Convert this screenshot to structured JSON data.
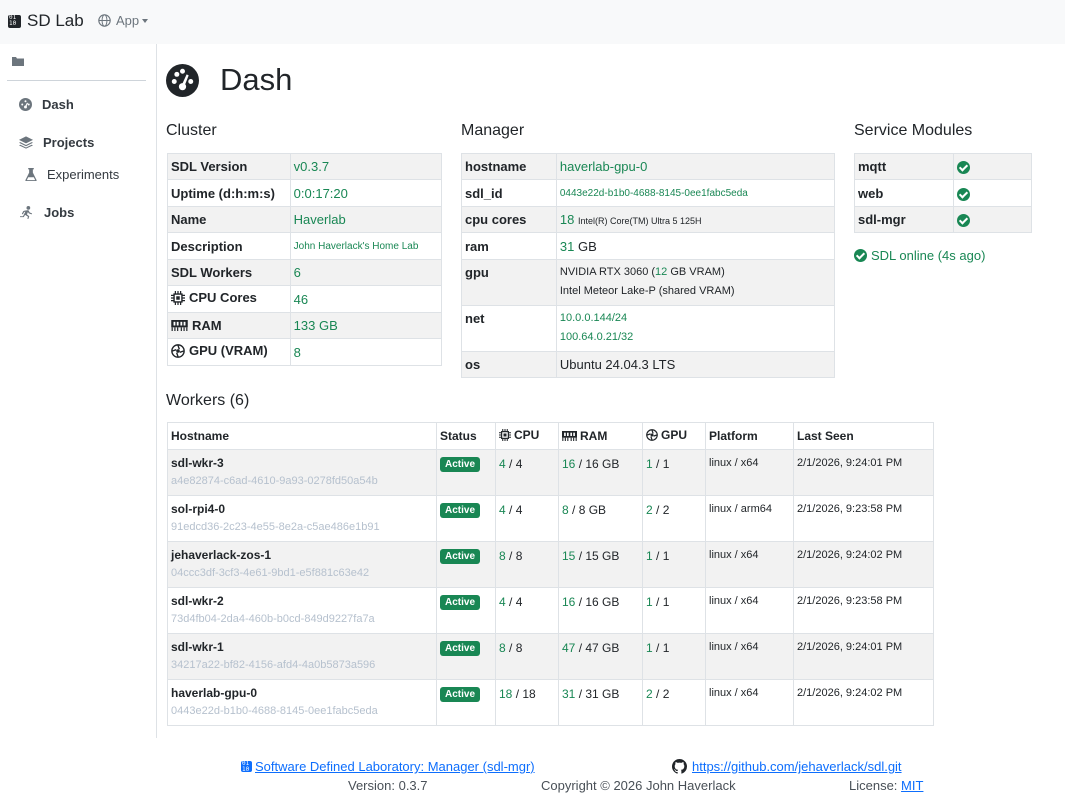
{
  "navbar": {
    "brand": "SD Lab",
    "app_menu": "App"
  },
  "sidebar": {
    "items": [
      {
        "label": "Dash",
        "icon": "gauge-icon"
      },
      {
        "label": "Projects",
        "icon": "layers-icon"
      },
      {
        "label": "Experiments",
        "icon": "flask-icon"
      },
      {
        "label": "Jobs",
        "icon": "person-running-icon"
      }
    ]
  },
  "page": {
    "title": "Dash"
  },
  "cluster": {
    "heading": "Cluster",
    "sdl_version_label": "SDL Version",
    "sdl_version": "v0.3.7",
    "uptime_label": "Uptime (d:h:m:s)",
    "uptime": "0:0:17:20",
    "name_label": "Name",
    "name": "Haverlab",
    "description_label": "Description",
    "description": "John Haverlack's Home Lab",
    "workers_label": "SDL Workers",
    "workers": "6",
    "cpu_label": "CPU Cores",
    "cpu": "46",
    "ram_label": "RAM",
    "ram": "133 GB",
    "gpu_label": "GPU (VRAM)",
    "gpu": "8"
  },
  "manager": {
    "heading": "Manager",
    "hostname_label": "hostname",
    "hostname": "haverlab-gpu-0",
    "sdl_id_label": "sdl_id",
    "sdl_id": "0443e22d-b1b0-4688-8145-0ee1fabc5eda",
    "cpu_label": "cpu cores",
    "cpu_count": "18",
    "cpu_model": "Intel(R) Core(TM) Ultra 5 125H",
    "ram_label": "ram",
    "ram_value": "31",
    "ram_unit": "GB",
    "gpu_label": "gpu",
    "gpu1_pre": "NVIDIA RTX 3060 (",
    "gpu1_vram": "12",
    "gpu1_post": " GB VRAM)",
    "gpu2": "Intel Meteor Lake-P (shared VRAM)",
    "net_label": "net",
    "net1": "10.0.0.144/24",
    "net2": "100.64.0.21/32",
    "os_label": "os",
    "os": "Ubuntu 24.04.3 LTS"
  },
  "services": {
    "heading": "Service Modules",
    "modules": [
      "mqtt",
      "web",
      "sdl-mgr"
    ],
    "status": "SDL online (4s ago)"
  },
  "workers": {
    "heading": "Workers (6)",
    "columns": {
      "hostname": "Hostname",
      "status": "Status",
      "cpu": "CPU",
      "ram": "RAM",
      "gpu": "GPU",
      "platform": "Platform",
      "last_seen": "Last Seen"
    },
    "rows": [
      {
        "host": "sdl-wkr-3",
        "id": "a4e82874-c6ad-4610-9a93-0278fd50a54b",
        "status": "Active",
        "cpu_free": "4",
        "cpu_total": " / 4",
        "ram_free": "16",
        "ram_total": " / 16 GB",
        "gpu_free": "1",
        "gpu_total": " / 1",
        "platform": "linux / x64",
        "seen": "2/1/2026, 9:24:01 PM"
      },
      {
        "host": "sol-rpi4-0",
        "id": "91edcd36-2c23-4e55-8e2a-c5ae486e1b91",
        "status": "Active",
        "cpu_free": "4",
        "cpu_total": " / 4",
        "ram_free": "8",
        "ram_total": " / 8 GB",
        "gpu_free": "2",
        "gpu_total": " / 2",
        "platform": "linux / arm64",
        "seen": "2/1/2026, 9:23:58 PM"
      },
      {
        "host": "jehaverlack-zos-1",
        "id": "04ccc3df-3cf3-4e61-9bd1-e5f881c63e42",
        "status": "Active",
        "cpu_free": "8",
        "cpu_total": " / 8",
        "ram_free": "15",
        "ram_total": " / 15 GB",
        "gpu_free": "1",
        "gpu_total": " / 1",
        "platform": "linux / x64",
        "seen": "2/1/2026, 9:24:02 PM"
      },
      {
        "host": "sdl-wkr-2",
        "id": "73d4fb04-2da4-460b-b0cd-849d9227fa7a",
        "status": "Active",
        "cpu_free": "4",
        "cpu_total": " / 4",
        "ram_free": "16",
        "ram_total": " / 16 GB",
        "gpu_free": "1",
        "gpu_total": " / 1",
        "platform": "linux / x64",
        "seen": "2/1/2026, 9:23:58 PM"
      },
      {
        "host": "sdl-wkr-1",
        "id": "34217a22-bf82-4156-afd4-4a0b5873a596",
        "status": "Active",
        "cpu_free": "8",
        "cpu_total": " / 8",
        "ram_free": "47",
        "ram_total": " / 47 GB",
        "gpu_free": "1",
        "gpu_total": " / 1",
        "platform": "linux / x64",
        "seen": "2/1/2026, 9:24:01 PM"
      },
      {
        "host": "haverlab-gpu-0",
        "id": "0443e22d-b1b0-4688-8145-0ee1fabc5eda",
        "status": "Active",
        "cpu_free": "18",
        "cpu_total": " / 18",
        "ram_free": "31",
        "ram_total": " / 31 GB",
        "gpu_free": "2",
        "gpu_total": " / 2",
        "platform": "linux / x64",
        "seen": "2/1/2026, 9:24:02 PM"
      }
    ]
  },
  "footer": {
    "project_link": "Software Defined Laboratory: Manager (sdl-mgr)",
    "repo_link": "https://github.com/jehaverlack/sdl.git",
    "version": "Version: 0.3.7",
    "copyright": "Copyright © 2026 John Haverlack",
    "license_label": "License: ",
    "license_link": "MIT"
  }
}
